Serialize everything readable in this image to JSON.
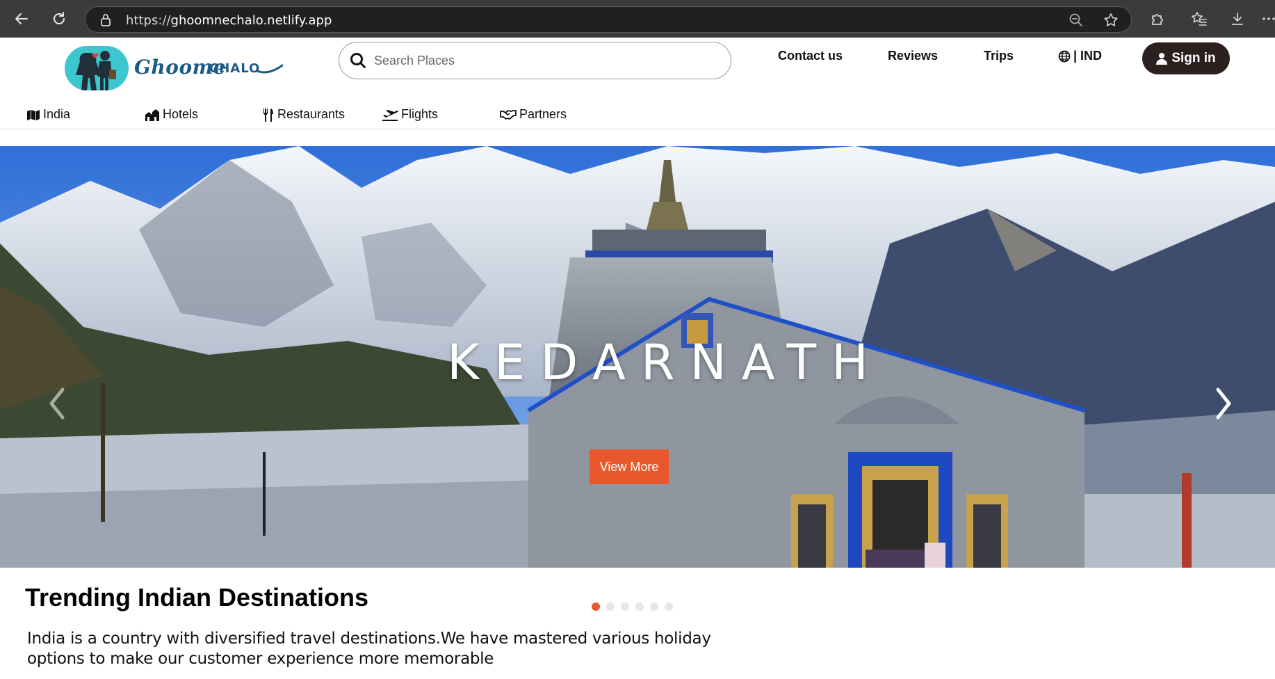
{
  "browser": {
    "url_scheme": "https://",
    "url_host": "ghoomnechalo.netlify.app"
  },
  "header": {
    "brand_script": "Ghoome",
    "brand_caps": "CHALO",
    "search_placeholder": "Search Places",
    "links": [
      "Contact us",
      "Reviews",
      "Trips"
    ],
    "region": "| IND",
    "signin": "Sign in"
  },
  "subnav": {
    "items": [
      {
        "label": "India",
        "icon": "map-icon"
      },
      {
        "label": "Hotels",
        "icon": "hotel-icon"
      },
      {
        "label": "Restaurants",
        "icon": "utensils-icon"
      },
      {
        "label": "Flights",
        "icon": "plane-departure-icon"
      },
      {
        "label": "Partners",
        "icon": "handshake-icon"
      }
    ]
  },
  "hero": {
    "title": "KEDARNATH",
    "button": "View More",
    "slides_total": 6,
    "active_slide": 1
  },
  "trending": {
    "title": "Trending Indian Destinations",
    "description": "India is a country with diversified travel destinations.We have mastered various holiday options to make our customer experience more memorable"
  },
  "colors": {
    "accent": "#e9582c",
    "signin_bg": "#2c1f1f",
    "logo_teal": "#3cc7cf",
    "brand_blue": "#1a5a88"
  }
}
